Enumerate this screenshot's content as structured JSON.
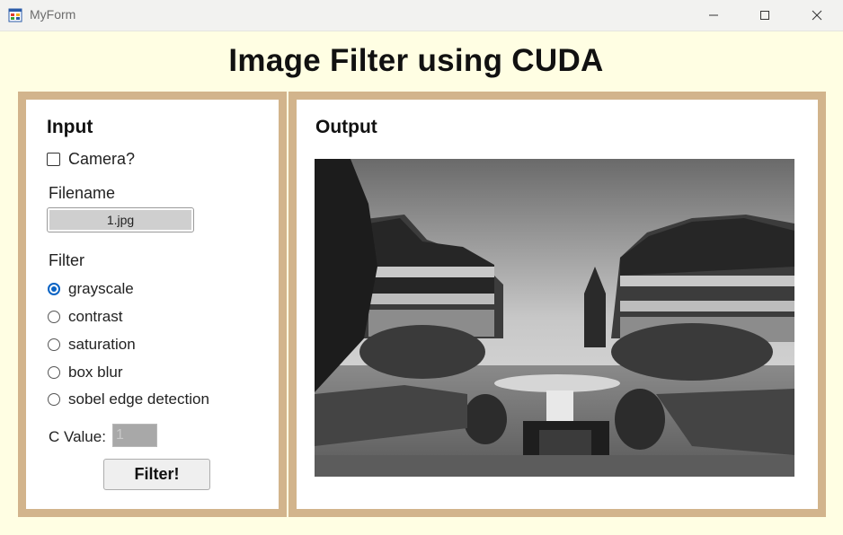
{
  "window": {
    "title": "MyForm"
  },
  "main": {
    "heading": "Image Filter using CUDA"
  },
  "input_panel": {
    "label": "Input",
    "camera_checkbox": {
      "label": "Camera?",
      "checked": false
    },
    "filename_label": "Filename",
    "filename_value": "1.jpg",
    "filter_label": "Filter",
    "filters": [
      {
        "label": "grayscale",
        "selected": true
      },
      {
        "label": "contrast",
        "selected": false
      },
      {
        "label": "saturation",
        "selected": false
      },
      {
        "label": "box blur",
        "selected": false
      },
      {
        "label": "sobel edge detection",
        "selected": false
      }
    ],
    "c_value_label": "C Value:",
    "c_value": "1",
    "filter_button": "Filter!"
  },
  "output_panel": {
    "label": "Output"
  },
  "colors": {
    "panel_border": "#d2b48c",
    "background": "#fffee3",
    "radio_accent": "#0a63c4"
  }
}
